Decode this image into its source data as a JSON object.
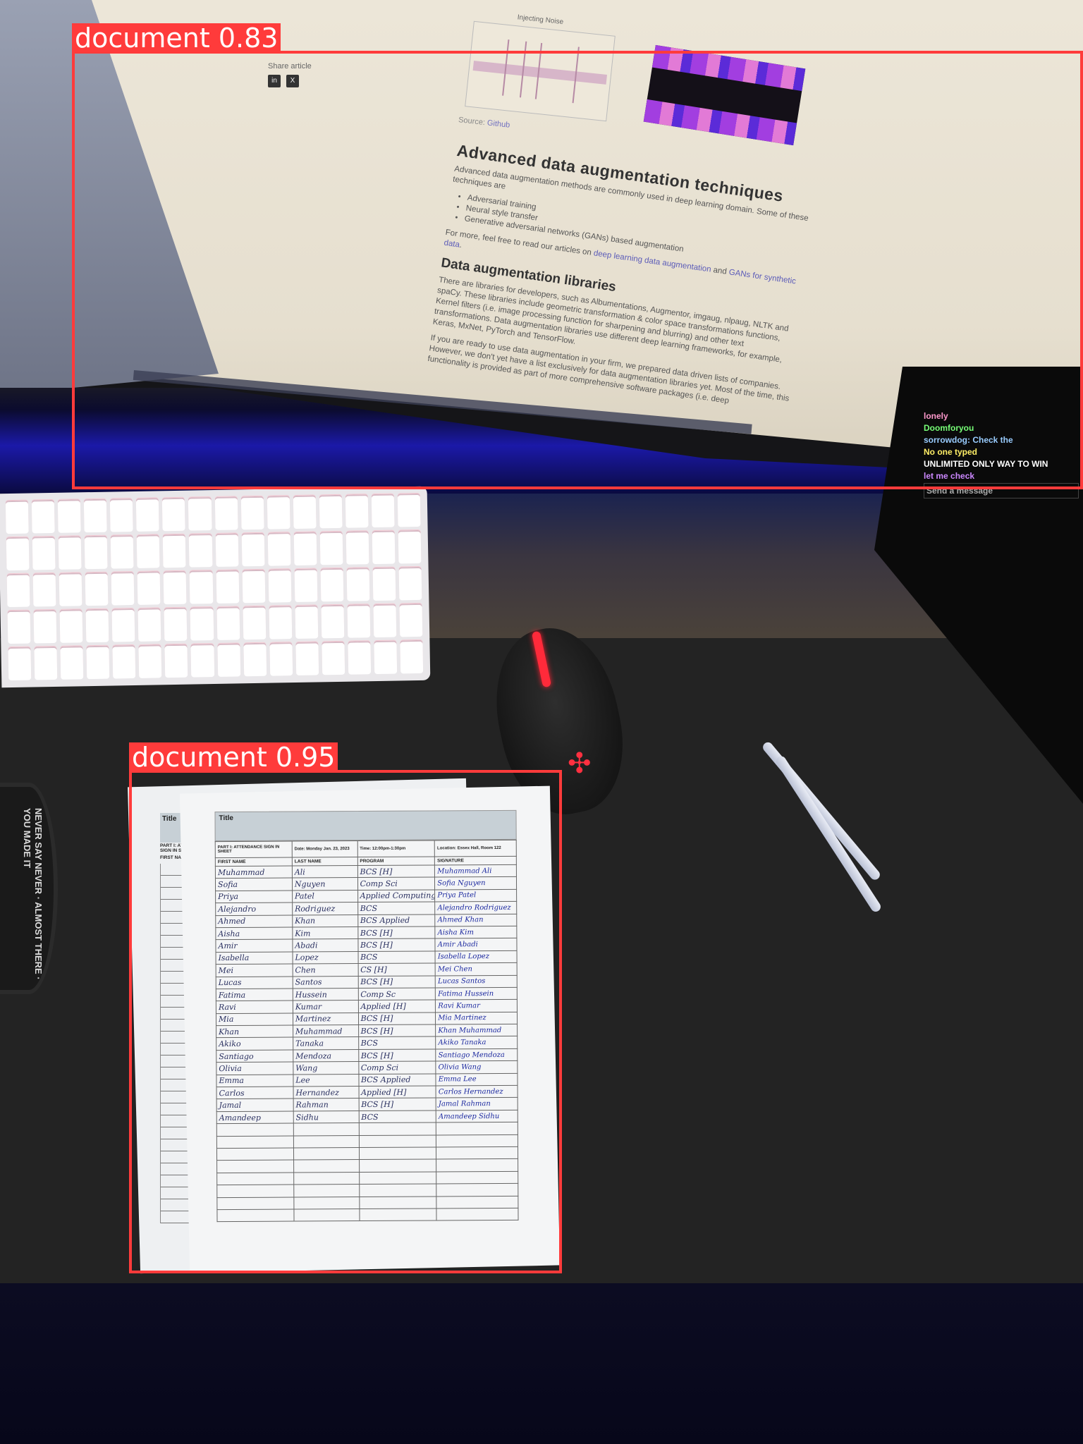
{
  "detections": [
    {
      "label": "document",
      "score": "0.83",
      "color": "#ff3b3b"
    },
    {
      "label": "document",
      "score": "0.95",
      "color": "#ff3b3b"
    }
  ],
  "monitor": {
    "share_label": "Share article",
    "social_icons": [
      "linkedin-icon",
      "x-icon"
    ],
    "chart_title_1": "Injecting Noise",
    "source_label": "Source:",
    "source_link": "Github",
    "heading_1": "Advanced data augmentation techniques",
    "intro": "Advanced data augmentation methods are commonly used in deep learning domain. Some of these techniques are",
    "bullets": [
      "Adversarial training",
      "Neural style transfer",
      "Generative adversarial networks (GANs) based augmentation"
    ],
    "more_prefix": "For more, feel free to read our articles on ",
    "more_link_1": "deep learning data augmentation",
    "more_mid": " and ",
    "more_link_2": "GANs for synthetic data",
    "more_suffix": ".",
    "heading_2": "Data augmentation libraries",
    "libraries_text": "There are libraries for developers, such as Albumentations, Augmentor, imgaug, nlpaug, NLTK and spaCy. These libraries include geometric transformation & color space transformations functions, Kernel filters (i.e. image processing function for sharpening and blurring) and other text transformations. Data augmentation libraries use different deep learning frameworks, for example, Keras, MxNet, PyTorch and TensorFlow.",
    "ready_text": "If you are ready to use data augmentation in your firm, we prepared data driven lists of companies. However, we don't yet have a list exclusively for data augmentation libraries yet. Most of the time, this functionality is provided as part of more comprehensive software packages (i.e. deep"
  },
  "coaster_text": "NEVER SAY NEVER · ALMOST THERE · YOU MADE IT",
  "side_monitor_chat": [
    "lonely",
    "Doomforyou",
    "sorrowdog: Check the",
    "No one typed",
    "UNLIMITED ONLY WAY TO WIN",
    "let me check",
    "Send a message"
  ],
  "sheet": {
    "title": "Title",
    "part_label": "PART I: ATTENDANCE SIGN IN SHEET",
    "date": "Date: Monday Jan. 23, 2023",
    "time": "Time: 12:00pm-1:30pm",
    "location": "Location: Essex Hall, Room 122",
    "columns": [
      "FIRST NAME",
      "LAST NAME",
      "PROGRAM",
      "SIGNATURE"
    ],
    "back_title": "Title",
    "back_part_label": "PART I: ATTENDANCE SIGN IN SHEET",
    "back_first_name": "FIRST NAME",
    "rows": [
      [
        "Muhammad",
        "Ali",
        "BCS [H]",
        "Muhammad Ali"
      ],
      [
        "Sofia",
        "Nguyen",
        "Comp Sci",
        "Sofia Nguyen"
      ],
      [
        "Priya",
        "Patel",
        "Applied Computing",
        "Priya Patel"
      ],
      [
        "Alejandro",
        "Rodriguez",
        "BCS",
        "Alejandro Rodriguez"
      ],
      [
        "Ahmed",
        "Khan",
        "BCS Applied",
        "Ahmed Khan"
      ],
      [
        "Aisha",
        "Kim",
        "BCS [H]",
        "Aisha Kim"
      ],
      [
        "Amir",
        "Abadi",
        "BCS [H]",
        "Amir Abadi"
      ],
      [
        "Isabella",
        "Lopez",
        "BCS",
        "Isabella Lopez"
      ],
      [
        "Mei",
        "Chen",
        "CS [H]",
        "Mei Chen"
      ],
      [
        "Lucas",
        "Santos",
        "BCS [H]",
        "Lucas Santos"
      ],
      [
        "Fatima",
        "Hussein",
        "Comp Sc",
        "Fatima Hussein"
      ],
      [
        "Ravi",
        "Kumar",
        "Applied [H]",
        "Ravi Kumar"
      ],
      [
        "Mia",
        "Martinez",
        "BCS [H]",
        "Mia Martinez"
      ],
      [
        "Khan",
        "Muhammad",
        "BCS [H]",
        "Khan Muhammad"
      ],
      [
        "Akiko",
        "Tanaka",
        "BCS",
        "Akiko Tanaka"
      ],
      [
        "Santiago",
        "Mendoza",
        "BCS [H]",
        "Santiago Mendoza"
      ],
      [
        "Olivia",
        "Wang",
        "Comp Sci",
        "Olivia Wang"
      ],
      [
        "Emma",
        "Lee",
        "BCS Applied",
        "Emma Lee"
      ],
      [
        "Carlos",
        "Hernandez",
        "Applied [H]",
        "Carlos Hernandez"
      ],
      [
        "Jamal",
        "Rahman",
        "BCS [H]",
        "Jamal Rahman"
      ],
      [
        "Amandeep",
        "Sidhu",
        "BCS",
        "Amandeep Sidhu"
      ]
    ],
    "empty_rows": 8
  }
}
